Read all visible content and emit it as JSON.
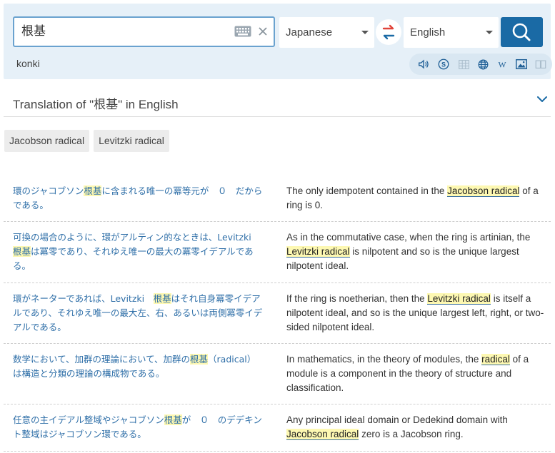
{
  "search": {
    "query": "根基",
    "romanization": "konki"
  },
  "languages": {
    "source": "Japanese",
    "target": "English"
  },
  "icons": {
    "keyboard": "keyboard-icon",
    "clear": "close-icon",
    "swap": "swap-icon",
    "search": "search-icon",
    "speaker": "speaker-icon",
    "skype": "skype-icon",
    "grid": "grid-icon",
    "globe": "globe-icon",
    "wikipedia": "wikipedia-icon",
    "image": "image-icon",
    "book": "book-icon",
    "chevron": "chevron-down-icon"
  },
  "translation_header": "Translation of \"根基\" in English",
  "chips": [
    "Jacobson radical",
    "Levitzki radical"
  ],
  "examples": [
    {
      "src": [
        "環のジャコブソン",
        "根基",
        "に含まれる唯一の冪等元が　０　だからである。"
      ],
      "tgt": [
        "The only idempotent contained in the ",
        "Jacobson radical",
        " of a ring is 0."
      ]
    },
    {
      "src": [
        "可換の場合のように、環がアルティン的なときは、Levitzki　",
        "根基",
        "は冪零であり、それゆえ唯一の最大の冪零イデアルである。"
      ],
      "tgt": [
        "As in the commutative case, when the ring is artinian, the ",
        "Levitzki radical",
        " is nilpotent and so is the unique largest nilpotent ideal."
      ]
    },
    {
      "src": [
        "環がネーターであれば、Levitzki　",
        "根基",
        "はそれ自身冪零イデアルであり、それゆえ唯一の最大左、右、あるいは両側冪零イデアルである。"
      ],
      "tgt": [
        "If the ring is noetherian, then the ",
        "Levitzki radical",
        " is itself a nilpotent ideal, and so is the unique largest left, right, or two-sided nilpotent ideal."
      ]
    },
    {
      "src": [
        "数学において、加群の理論において、加群の",
        "根基",
        "（radical）　は構造と分類の理論の構成物である。"
      ],
      "tgt": [
        "In mathematics, in the theory of modules, the ",
        "radical",
        " of a module is a component in the theory of structure and classification."
      ]
    },
    {
      "src": [
        "任意の主イデアル整域やジャコブソン",
        "根基",
        "が　０　のデデキント整域はジャコブソン環である。"
      ],
      "tgt": [
        "Any principal ideal domain or Dedekind domain with ",
        "Jacobson radical",
        " zero is a Jacobson ring."
      ]
    }
  ],
  "colors": {
    "accent": "#1a6aa5",
    "highlight": "#fdf8b2",
    "source_text": "#2f6fa8"
  }
}
